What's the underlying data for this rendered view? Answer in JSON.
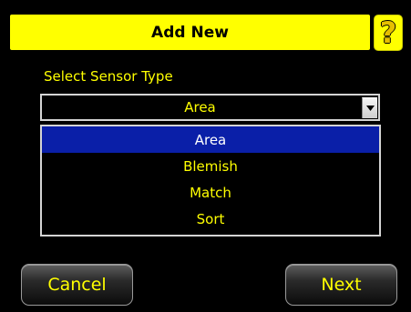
{
  "header": {
    "title": "Add New",
    "help_icon": "question-mark-icon",
    "help_glyph": "?"
  },
  "form": {
    "select_label": "Select Sensor Type",
    "selected_value": "Area",
    "options": [
      "Area",
      "Blemish",
      "Match",
      "Sort"
    ],
    "highlighted_index": 0
  },
  "footer": {
    "cancel_label": "Cancel",
    "next_label": "Next"
  },
  "colors": {
    "background": "#000000",
    "accent_yellow": "#ffff00",
    "selection_blue": "#0a1fa8",
    "border_gray": "#d4d4d4"
  }
}
